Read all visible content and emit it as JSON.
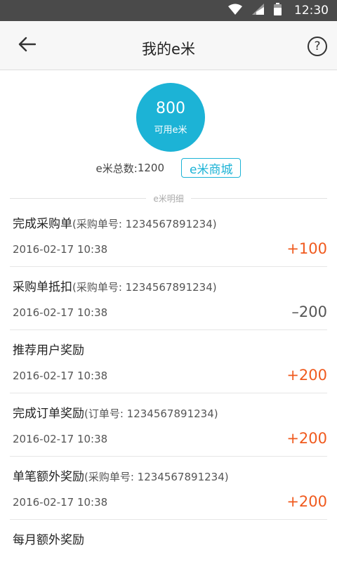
{
  "status_bar": {
    "time": "12:30",
    "icons": [
      "wifi-icon",
      "cell-signal-icon",
      "battery-icon"
    ]
  },
  "app_bar": {
    "title": "我的e米",
    "back_icon": "arrow-left-icon",
    "help_icon": "question-icon",
    "help_glyph": "?"
  },
  "summary": {
    "available_value": "800",
    "available_label": "可用e米",
    "total_label": "e米总数:",
    "total_value": "1200",
    "mall_button": "e米商城"
  },
  "section_label": "e米明细",
  "records": [
    {
      "title": "完成采购单",
      "note": "(采购单号: 1234567891234)",
      "time": "2016-02-17  10:38",
      "amount": "+100",
      "type": "plus"
    },
    {
      "title": "采购单抵扣",
      "note": "(采购单号: 1234567891234)",
      "time": "2016-02-17  10:38",
      "amount": "–200",
      "type": "minus"
    },
    {
      "title": "推荐用户奖励",
      "note": "",
      "time": "2016-02-17  10:38",
      "amount": "+200",
      "type": "plus"
    },
    {
      "title": "完成订单奖励",
      "note": "(订单号: 1234567891234)",
      "time": "2016-02-17  10:38",
      "amount": "+200",
      "type": "plus"
    },
    {
      "title": "单笔额外奖励",
      "note": "(采购单号: 1234567891234)",
      "time": "2016-02-17  10:38",
      "amount": "+200",
      "type": "plus"
    },
    {
      "title": "每月额外奖励",
      "note": "",
      "time": "",
      "amount": "",
      "type": "plus"
    }
  ],
  "colors": {
    "accent": "#1cb3d6",
    "plus": "#f05a1e",
    "minus": "#555555",
    "status_bar": "#4a4a4a"
  }
}
